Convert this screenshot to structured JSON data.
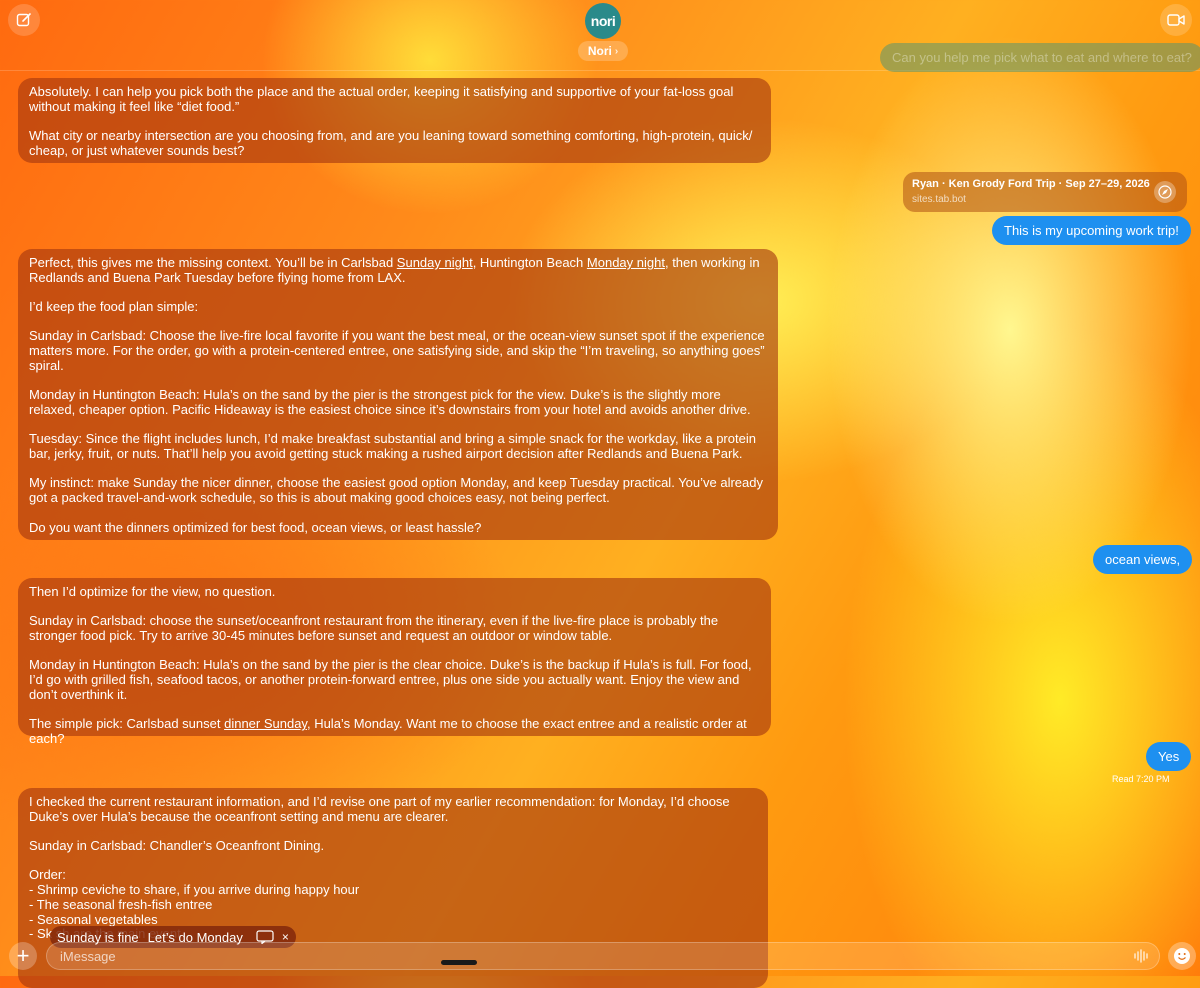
{
  "header": {
    "avatar_text": "nori",
    "contact_name": "Nori",
    "contact_chevron": "›",
    "compose_icon": "compose-icon",
    "video_icon": "video-camera-icon"
  },
  "messages": {
    "out_1": "Can you help me pick what to eat and where to eat?",
    "in_1": {
      "p1": "Absolutely. I can help you pick both the place and the actual order, keeping it satisfying and supportive of your fat-loss goal without making it feel like “diet food.”",
      "p2": "What city or nearby intersection are you choosing from, and are you leaning toward something comforting, high-protein, quick/ cheap, or just whatever sounds best?"
    },
    "link_card": {
      "title": "Ryan · Ken Grody Ford Trip · Sep 27–29, 2026",
      "site": "sites.tab.bot"
    },
    "out_2": "This is my upcoming work trip!",
    "in_2": {
      "p1_a": "Perfect, this gives me the missing context. You’ll be in Carlsbad ",
      "p1_u1": "Sunday night",
      "p1_b": ", Huntington Beach ",
      "p1_u2": "Monday night",
      "p1_c": ", then working in Redlands and Buena Park Tuesday before flying home from LAX.",
      "p2": "I’d keep the food plan simple:",
      "p3": "Sunday in Carlsbad: Choose the live-fire local favorite if you want the best meal, or the ocean-view sunset spot if the experience matters more. For the order, go with a protein-centered entree, one satisfying side, and skip the “I’m traveling, so anything goes” spiral.",
      "p4": "Monday in Huntington Beach: Hula’s on the sand by the pier is the strongest pick for the view. Duke’s is the slightly more relaxed, cheaper option. Pacific Hideaway is the easiest choice since it’s downstairs from your hotel and avoids another drive.",
      "p5": "Tuesday: Since the flight includes lunch, I’d make breakfast substantial and bring a simple snack for the workday, like a protein bar, jerky, fruit, or nuts. That’ll help you avoid getting stuck making a rushed airport decision after Redlands and Buena Park.",
      "p6": "My instinct: make Sunday the nicer dinner, choose the easiest good option Monday, and keep Tuesday practical. You’ve already got a packed travel-and-work schedule, so this is about making good choices easy, not being perfect.",
      "p7": "Do you want the dinners optimized for best food, ocean views, or least hassle?"
    },
    "out_3": "ocean views,",
    "in_3": {
      "p1": "Then I’d optimize for the view, no question.",
      "p2": "Sunday in Carlsbad: choose the sunset/oceanfront restaurant from the itinerary, even if the live-fire place is probably the stronger food pick. Try to arrive 30-45 minutes before sunset and request an outdoor or window table.",
      "p3": "Monday in Huntington Beach: Hula’s on the sand by the pier is the clear choice. Duke’s is the backup if Hula’s is full. For food, I’d go with grilled fish, seafood tacos, or another protein-forward entree, plus one side you actually want. Enjoy the view and don’t overthink it.",
      "p4_a": "The simple pick: Carlsbad sunset ",
      "p4_u": "dinner Sunday",
      "p4_b": ", Hula’s Monday. Want me to choose the exact entree and a realistic order at each?"
    },
    "out_4": "Yes",
    "read_status": "Read 7:20 PM",
    "in_4": {
      "p1": "I checked the current restaurant information, and I’d revise one part of my earlier recommendation: for Monday, I’d choose Duke’s over Hula’s because the oceanfront setting and menu are clearer.",
      "p2": "Sunday in Carlsbad: Chandler’s Oceanfront Dining.",
      "p3": "Order:\n- Shrimp ceviche to share, if you arrive during happy hour\n- The seasonal fresh-fish entree\n- Seasonal vegetables\n- Sk                                                              sh are the main event"
    }
  },
  "suggestions": {
    "chip_1": "Sunday is fine",
    "chip_2": "Let’s do Monday",
    "close": "×"
  },
  "composer": {
    "placeholder": "iMessage",
    "add_label": "+"
  }
}
